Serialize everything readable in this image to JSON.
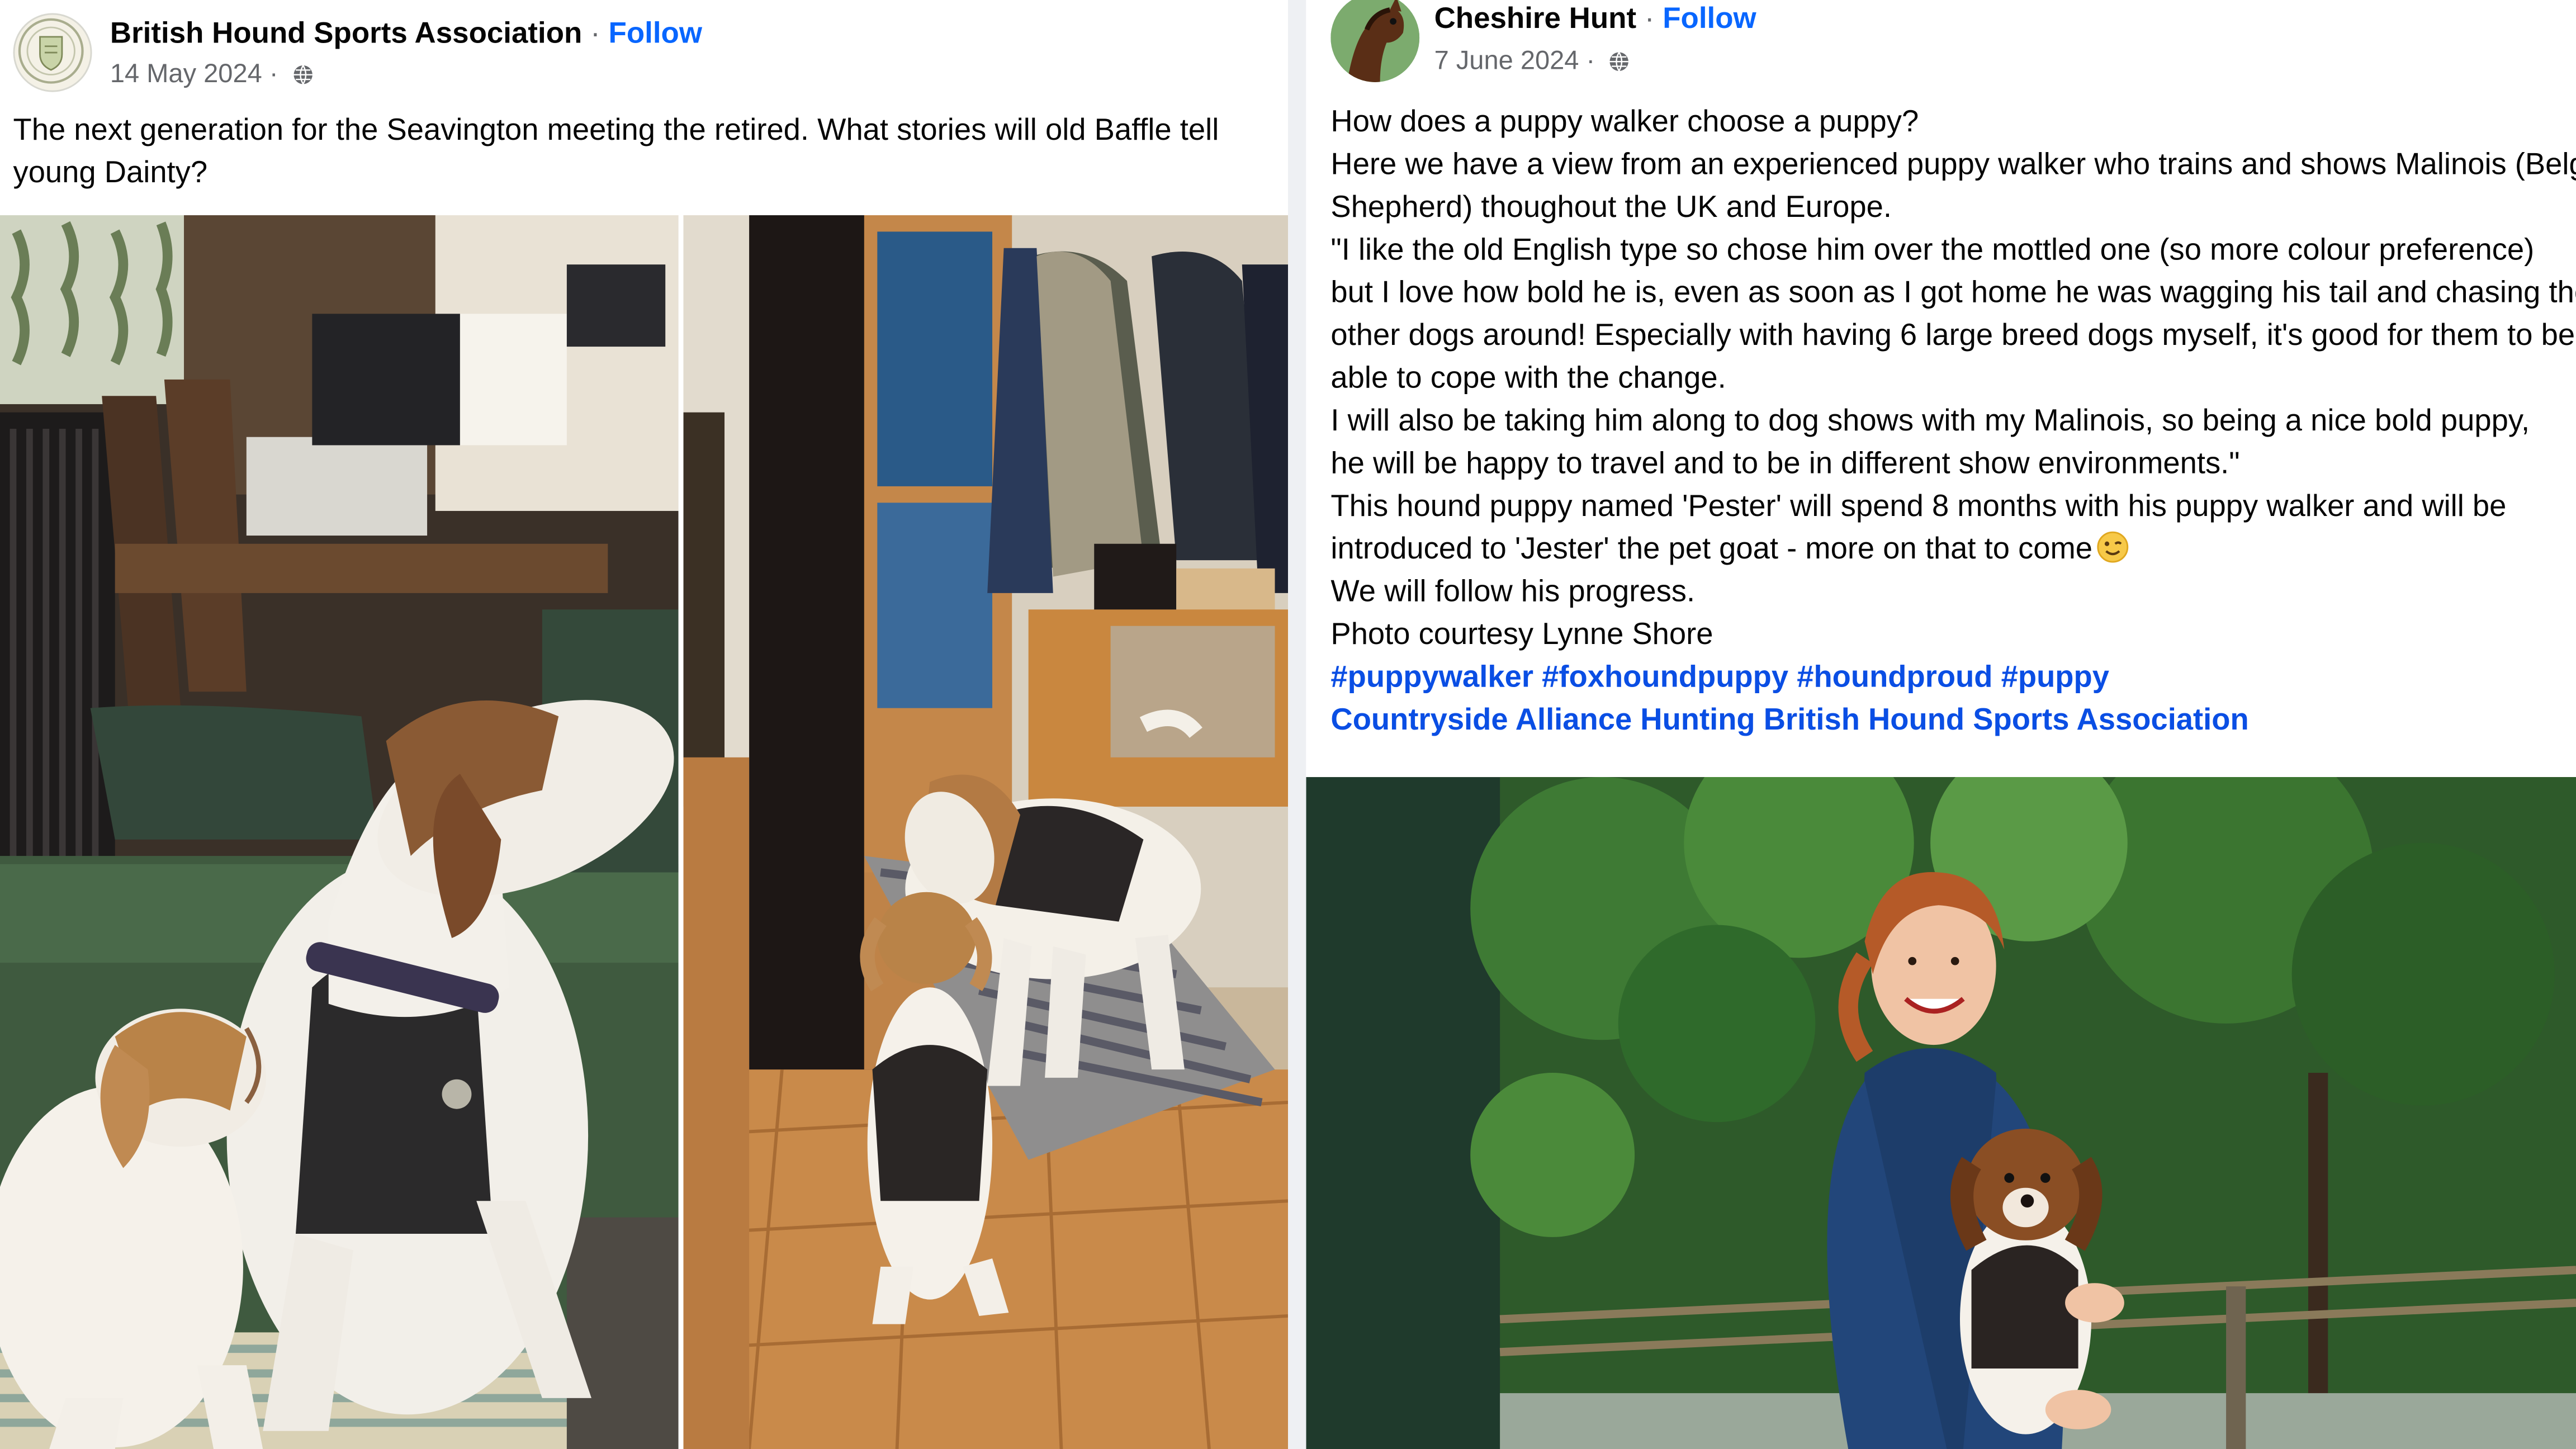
{
  "left_post": {
    "author": "British Hound Sports Association",
    "separator": "·",
    "follow_label": "Follow",
    "date": "14 May 2024",
    "date_separator": "·",
    "privacy_icon": "globe-icon",
    "avatar_icon": "association-crest-icon",
    "text_lines": [
      "The next generation for the Seavington meeting the retired. What stories will old Baffle tell",
      "young Dainty?"
    ],
    "photos": [
      "photo-two-hounds-on-sofa",
      "photo-hounds-in-hallway"
    ]
  },
  "right_post": {
    "author": "Cheshire Hunt",
    "separator": "·",
    "follow_label": "Follow",
    "date": "7 June 2024",
    "date_separator": "·",
    "privacy_icon": "globe-icon",
    "avatar_icon": "horse-head-icon",
    "text_lines": [
      "How does a puppy walker choose a puppy?",
      "Here we have a view from an experienced puppy walker who trains and shows Malinois (Belgian",
      "Shepherd) thoughout the UK and Europe.",
      "\"I like the old English type so chose him over the mottled one (so more colour preference)",
      "but I love how bold he is, even as soon as I got home he was wagging his tail and chasing the",
      "other dogs around! Especially with having 6 large breed dogs myself, it's good for them to be",
      "able to cope with the change.",
      "I will also be taking him along to dog shows with my Malinois, so being a nice bold puppy,",
      "he will be happy to travel and to be in different show environments.\"",
      "This hound puppy named 'Pester' will spend 8 months with his puppy walker and will be",
      "introduced to 'Jester' the pet goat - more on that to come",
      "We will follow his progress.",
      "Photo courtesy Lynne Shore"
    ],
    "emoji_icon": "winking-face-icon",
    "hashtags": [
      "#puppywalker",
      "#foxhoundpuppy",
      "#houndproud",
      "#puppy"
    ],
    "mentions": [
      "Countryside Alliance Hunting",
      "British Hound Sports Association"
    ],
    "photos": [
      "photo-woman-holding-puppy"
    ]
  }
}
